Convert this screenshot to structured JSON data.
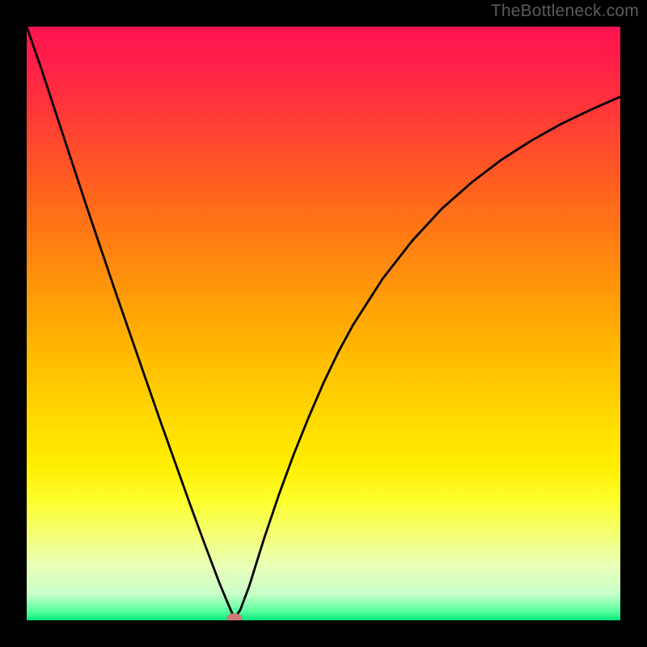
{
  "watermark_text": "TheBottleneck.com",
  "chart_data": {
    "type": "line",
    "title": "",
    "xlabel": "",
    "ylabel": "",
    "xlim": [
      0,
      100
    ],
    "ylim": [
      0,
      100
    ],
    "grid": false,
    "legend": false,
    "background_gradient": {
      "stops": [
        {
          "offset": 0,
          "color": "#ff1450"
        },
        {
          "offset": 0.06,
          "color": "#ff1e48"
        },
        {
          "offset": 0.15,
          "color": "#ff3a36"
        },
        {
          "offset": 0.25,
          "color": "#ff5a22"
        },
        {
          "offset": 0.35,
          "color": "#ff7a14"
        },
        {
          "offset": 0.45,
          "color": "#ff9a08"
        },
        {
          "offset": 0.55,
          "color": "#ffba00"
        },
        {
          "offset": 0.65,
          "color": "#ffd600"
        },
        {
          "offset": 0.74,
          "color": "#ffee00"
        },
        {
          "offset": 0.8,
          "color": "#fdff2e"
        },
        {
          "offset": 0.86,
          "color": "#f3ff7a"
        },
        {
          "offset": 0.91,
          "color": "#e8ffb8"
        },
        {
          "offset": 0.955,
          "color": "#c9ffc9"
        },
        {
          "offset": 0.985,
          "color": "#58ff9e"
        },
        {
          "offset": 1.0,
          "color": "#00e878"
        }
      ]
    },
    "series": [
      {
        "name": "bottleneck-v-curve",
        "type": "line",
        "x": [
          0.0,
          2.5,
          5.0,
          7.5,
          10.0,
          12.5,
          15.0,
          17.5,
          20.0,
          22.5,
          25.0,
          27.5,
          30.0,
          32.5,
          34.0,
          35.0,
          36.0,
          37.5,
          40.0,
          42.5,
          45.0,
          47.5,
          50.0,
          52.5,
          55.0,
          60.0,
          65.0,
          70.0,
          75.0,
          80.0,
          85.0,
          90.0,
          95.0,
          100.0
        ],
        "y": [
          100.0,
          92.8,
          85.2,
          77.6,
          70.0,
          62.6,
          55.2,
          48.0,
          40.8,
          33.6,
          26.6,
          19.6,
          12.8,
          6.2,
          2.6,
          0.3,
          1.8,
          5.8,
          13.8,
          21.2,
          28.0,
          34.2,
          40.0,
          45.2,
          49.8,
          57.6,
          64.0,
          69.4,
          73.8,
          77.6,
          80.8,
          83.6,
          86.0,
          88.2
        ]
      }
    ],
    "marker": {
      "name": "optimal-point",
      "x": 35.0,
      "y": 0.3,
      "rx": 1.3,
      "ry": 0.9,
      "color": "#cf7a74"
    }
  },
  "plot_frame": {
    "outer_w": 800,
    "outer_h": 800,
    "inner_left": 33,
    "inner_top": 33,
    "inner_w": 734,
    "inner_h": 734
  }
}
